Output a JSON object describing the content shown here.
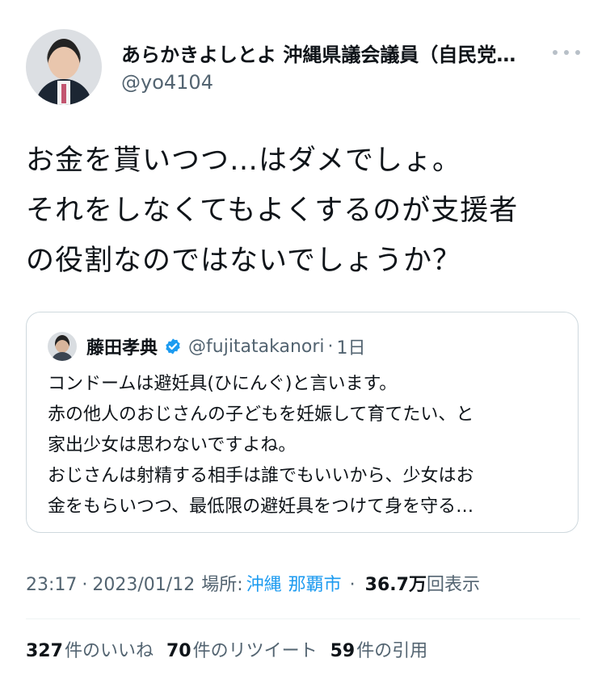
{
  "author": {
    "name": "あらかきよしとよ 沖縄県議会議員（自民党…",
    "handle": "@yo4104",
    "avatar": "person-photo"
  },
  "more_icon": "more-horizontal-icon",
  "tweet_text": "お金を貰いつつ…はダメでしょ。\nそれをしなくてもよくするのが支援者\nの役割なのではないでしょうか？",
  "quote": {
    "name": "藤田孝典",
    "verified_icon": "verified-badge-icon",
    "handle": "@fujitatakanori",
    "separator": "·",
    "time": "1日",
    "text": "コンドームは避妊具(ひにんぐ)と言います。\n赤の他人のおじさんの子どもを妊娠して育てたい、と\n家出少女は思わないですよね。\nおじさんは射精する相手は誰でもいいから、少女はお\n金をもらいつつ、最低限の避妊具をつけて身を守る…"
  },
  "meta": {
    "time": "23:17",
    "sep1": "·",
    "date": "2023/01/12",
    "location_label": "場所:",
    "location_city": "沖縄",
    "location_area": "那覇市",
    "sep2": "·",
    "views_count": "36.7万",
    "views_label": "回表示"
  },
  "stats": {
    "likes_count": "327",
    "likes_label": "件のいいね",
    "retweets_count": "70",
    "retweets_label": "件のリツイート",
    "quotes_count": "59",
    "quotes_label": "件の引用"
  },
  "colors": {
    "text": "#0f1419",
    "secondary": "#536471",
    "link": "#1d9bf0",
    "border": "#cfd9de"
  }
}
